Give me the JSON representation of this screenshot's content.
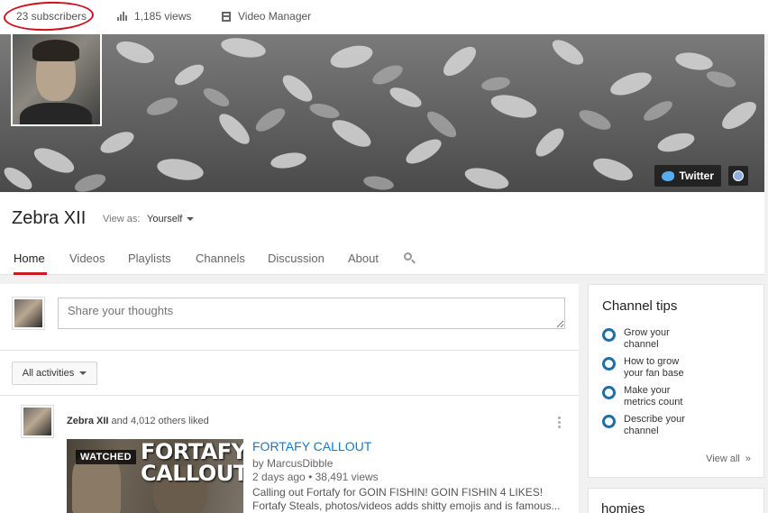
{
  "topbar": {
    "subscribers": "23 subscribers",
    "views": "1,185 views",
    "video_manager": "Video Manager"
  },
  "banner": {
    "twitter_label": "Twitter"
  },
  "channel": {
    "name": "Zebra XII",
    "view_as_label": "View as:",
    "view_as_value": "Yourself"
  },
  "tabs": [
    {
      "label": "Home"
    },
    {
      "label": "Videos"
    },
    {
      "label": "Playlists"
    },
    {
      "label": "Channels"
    },
    {
      "label": "Discussion"
    },
    {
      "label": "About"
    }
  ],
  "share": {
    "placeholder": "Share your thoughts"
  },
  "filter": {
    "label": "All activities"
  },
  "feed": {
    "actor": "Zebra XII",
    "action": "and 4,012 others liked",
    "thumbnail_badge": "WATCHED",
    "thumbnail_text_1": "FORTAFY",
    "thumbnail_text_2": "CALLOUT",
    "video_title": "FORTAFY CALLOUT",
    "video_by": "by MarcusDibble",
    "video_age": "2 days ago",
    "video_views": "38,491 views",
    "description_line_1": "Calling out Fortafy for GOIN FISHIN! GOIN FISHIN 4 LIKES!",
    "description_line_2": "Fortafy Steals, photos/videos adds shitty emojis and is famous..."
  },
  "channel_tips": {
    "title": "Channel tips",
    "items": [
      {
        "line1": "Grow your",
        "line2": "channel"
      },
      {
        "line1": "How to grow",
        "line2": "your fan base"
      },
      {
        "line1": "Make your",
        "line2": "metrics count"
      },
      {
        "line1": "Describe your",
        "line2": "channel"
      }
    ],
    "view_all": "View all",
    "view_all_arrow": "»"
  },
  "homies": {
    "title": "homies"
  },
  "colors": {
    "accent_red": "#cc181e",
    "link_blue": "#167ac6",
    "tip_circle_blue": "#1d6fa5"
  }
}
